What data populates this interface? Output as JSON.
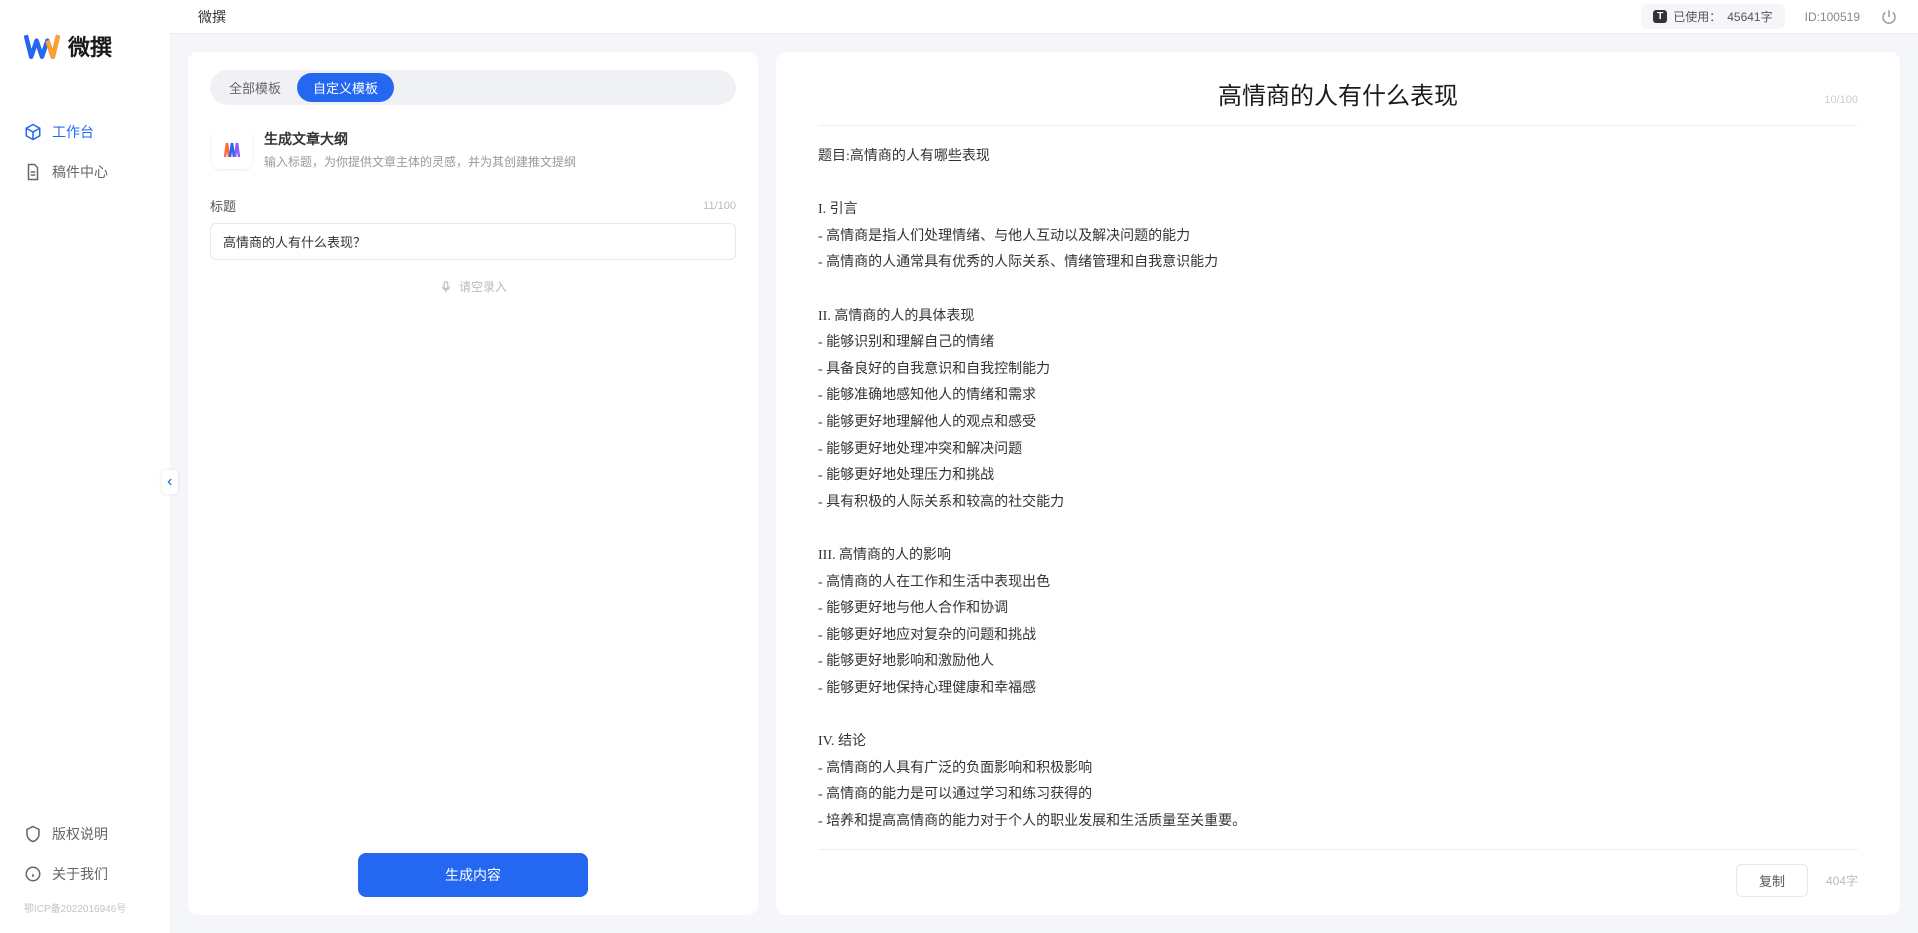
{
  "app": {
    "name": "微撰",
    "logo_text": "微撰"
  },
  "sidebar": {
    "items": [
      {
        "label": "工作台",
        "icon": "cube",
        "active": true
      },
      {
        "label": "稿件中心",
        "icon": "document",
        "active": false
      }
    ],
    "bottom_items": [
      {
        "label": "版权说明",
        "icon": "shield"
      },
      {
        "label": "关于我们",
        "icon": "info"
      }
    ],
    "icp": "鄂ICP备2022016946号"
  },
  "topbar": {
    "title": "微撰",
    "usage_badge": "T",
    "usage_label": "已使用：",
    "usage_value": "45641字",
    "user_id_label": "ID:",
    "user_id": "100519"
  },
  "left_panel": {
    "tabs": [
      {
        "label": "全部模板",
        "active": false
      },
      {
        "label": "自定义模板",
        "active": true
      }
    ],
    "template": {
      "title": "生成文章大纲",
      "desc": "输入标题，为你提供文章主体的灵感，并为其创建推文提纲"
    },
    "field": {
      "label": "标题",
      "counter": "11/100",
      "value": "高情商的人有什么表现？"
    },
    "voice_hint": "请空录入",
    "generate_btn": "生成内容"
  },
  "right_panel": {
    "title": "高情商的人有什么表现",
    "title_counter": "10/100",
    "body": "题目:高情商的人有哪些表现\n\nI. 引言\n- 高情商是指人们处理情绪、与他人互动以及解决问题的能力\n- 高情商的人通常具有优秀的人际关系、情绪管理和自我意识能力\n\nII. 高情商的人的具体表现\n- 能够识别和理解自己的情绪\n- 具备良好的自我意识和自我控制能力\n- 能够准确地感知他人的情绪和需求\n- 能够更好地理解他人的观点和感受\n- 能够更好地处理冲突和解决问题\n- 能够更好地处理压力和挑战\n- 具有积极的人际关系和较高的社交能力\n\nIII. 高情商的人的影响\n- 高情商的人在工作和生活中表现出色\n- 能够更好地与他人合作和协调\n- 能够更好地应对复杂的问题和挑战\n- 能够更好地影响和激励他人\n- 能够更好地保持心理健康和幸福感\n\nIV. 结论\n- 高情商的人具有广泛的负面影响和积极影响\n- 高情商的能力是可以通过学习和练习获得的\n- 培养和提高高情商的能力对于个人的职业发展和生活质量至关重要。",
    "copy_btn": "复制",
    "word_count": "404字"
  }
}
